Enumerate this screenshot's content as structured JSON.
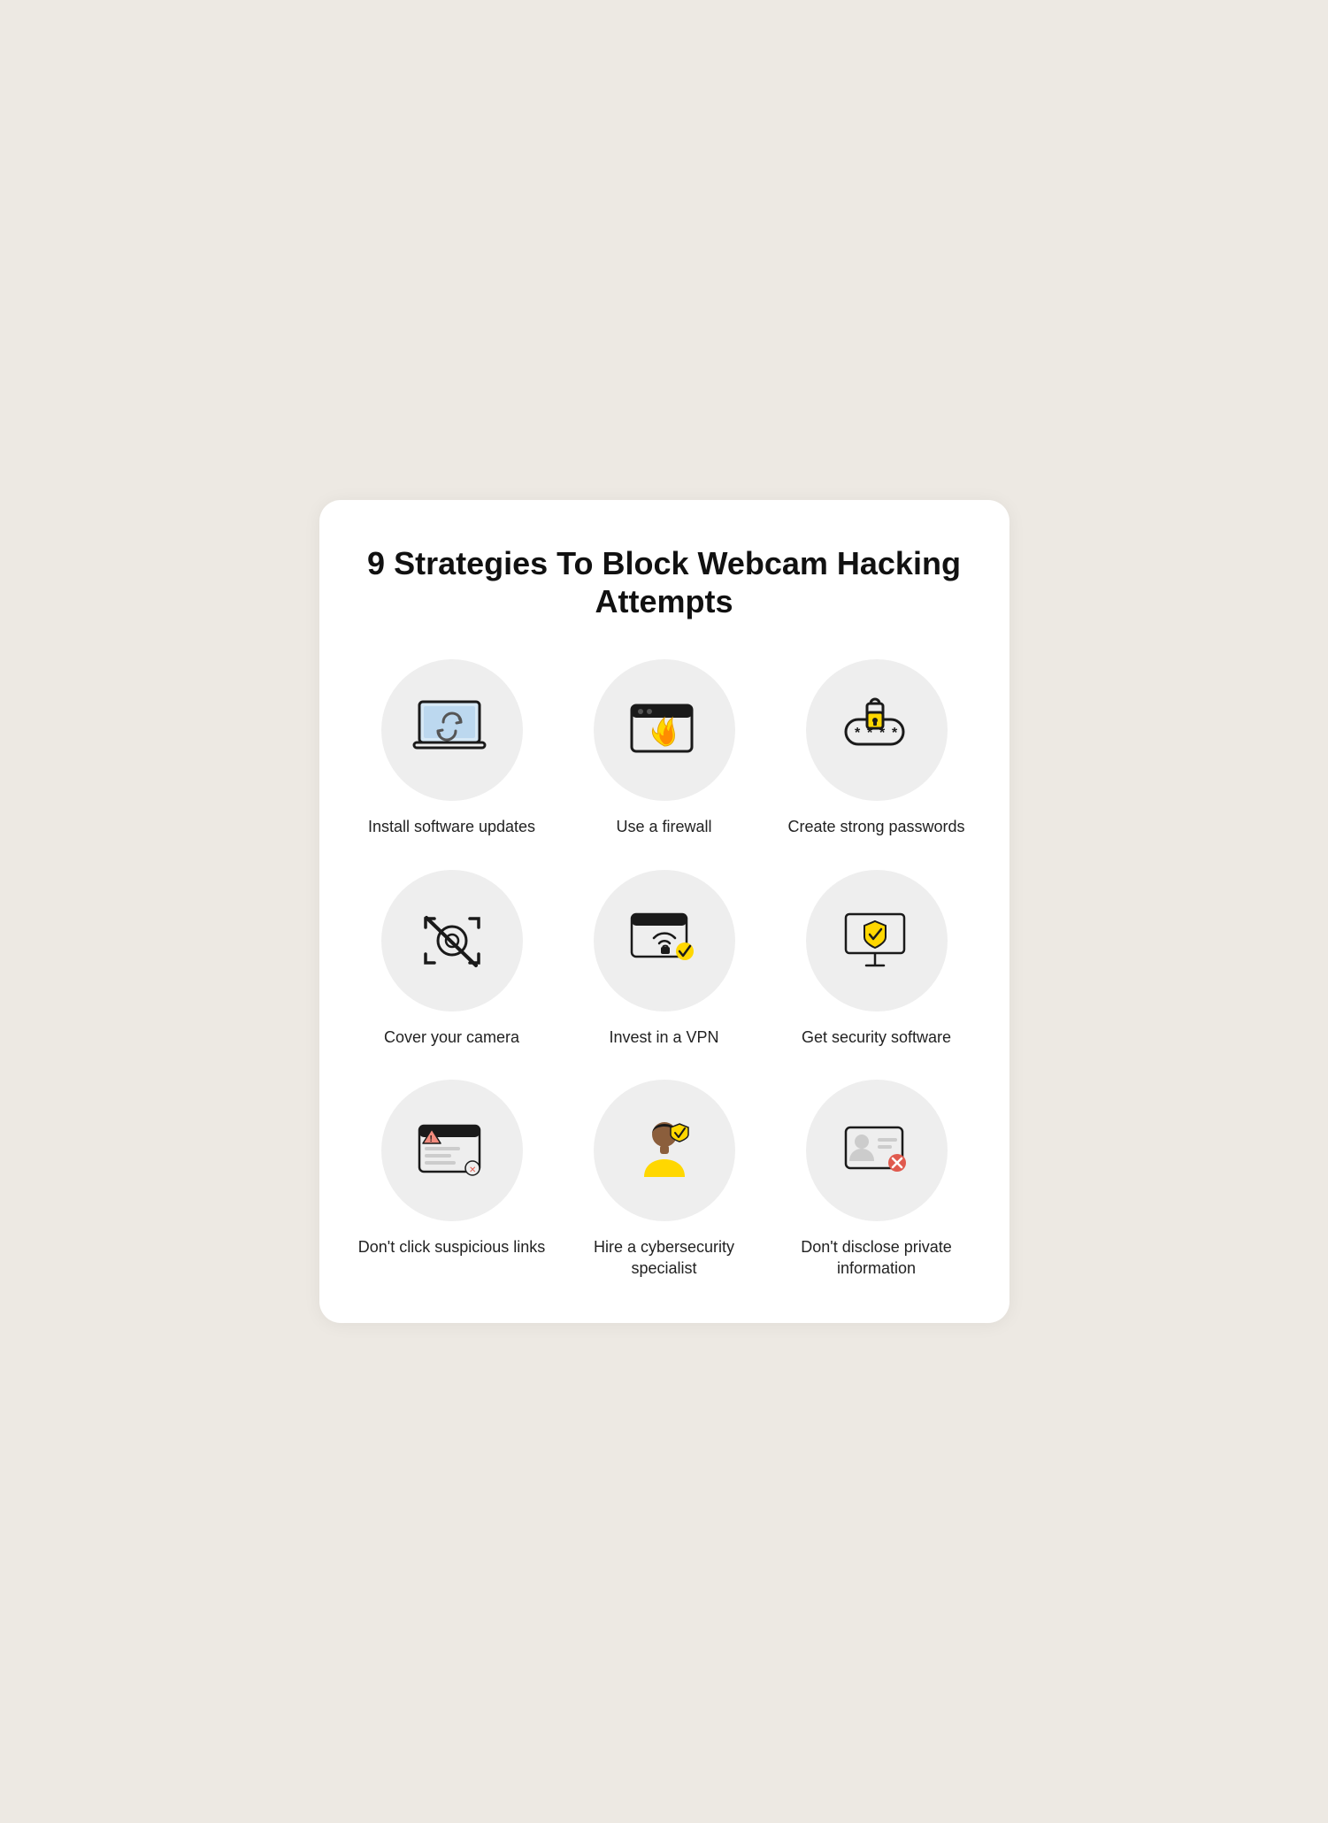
{
  "title": "9 Strategies To Block Webcam Hacking Attempts",
  "items": [
    {
      "id": "install-updates",
      "label": "Install software updates"
    },
    {
      "id": "use-firewall",
      "label": "Use a firewall"
    },
    {
      "id": "strong-passwords",
      "label": "Create strong passwords"
    },
    {
      "id": "cover-camera",
      "label": "Cover your camera"
    },
    {
      "id": "invest-vpn",
      "label": "Invest in a VPN"
    },
    {
      "id": "security-software",
      "label": "Get security software"
    },
    {
      "id": "suspicious-links",
      "label": "Don't click suspicious links"
    },
    {
      "id": "cybersecurity-specialist",
      "label": "Hire a cybersecurity specialist"
    },
    {
      "id": "private-info",
      "label": "Don't disclose private information"
    }
  ]
}
